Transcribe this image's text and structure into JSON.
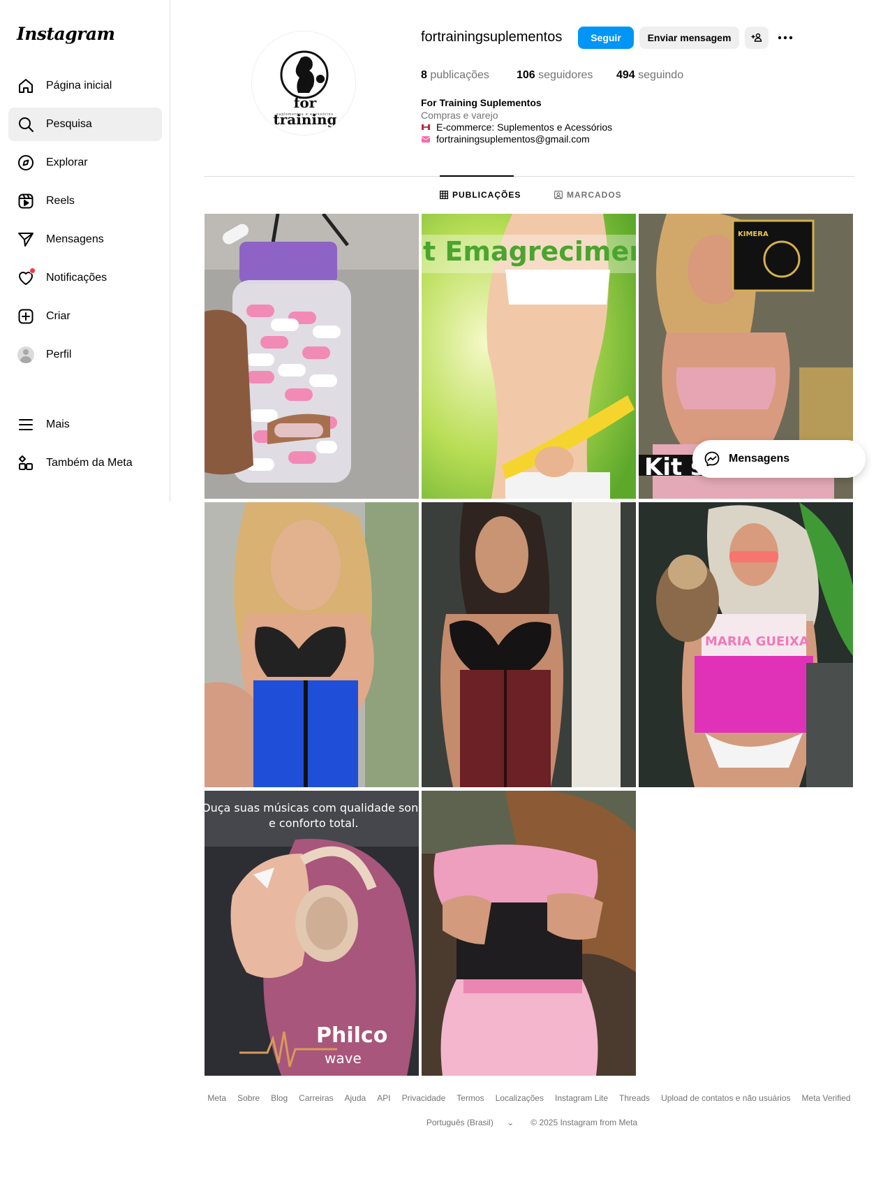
{
  "sidebar": {
    "logo": "Instagram",
    "items": [
      {
        "label": "Página inicial",
        "icon": "home-icon"
      },
      {
        "label": "Pesquisa",
        "icon": "search-icon"
      },
      {
        "label": "Explorar",
        "icon": "compass-icon"
      },
      {
        "label": "Reels",
        "icon": "reels-icon"
      },
      {
        "label": "Mensagens",
        "icon": "send-icon"
      },
      {
        "label": "Notificações",
        "icon": "heart-icon"
      },
      {
        "label": "Criar",
        "icon": "plus-square-icon"
      },
      {
        "label": "Perfil",
        "icon": "avatar-icon"
      },
      {
        "label": "Mais",
        "icon": "menu-icon"
      },
      {
        "label": "Também da Meta",
        "icon": "meta-apps-icon"
      }
    ]
  },
  "profile": {
    "username": "fortrainingsuplementos",
    "follow_label": "Seguir",
    "message_label": "Enviar mensagem",
    "logo_text_main": "for training",
    "logo_text_sub": "suplementos e acessórios",
    "stats": {
      "posts_count": "8",
      "posts_label": "publicações",
      "followers_count": "106",
      "followers_label": "seguidores",
      "following_count": "494",
      "following_label": "seguindo"
    },
    "bio": {
      "name": "For Training Suplementos",
      "category": "Compras e varejo",
      "line1": "E-commerce: Suplementos e Acessórios",
      "line2": "fortrainingsuplementos@gmail.com"
    }
  },
  "tabs": {
    "posts": "PUBLICAÇÕES",
    "tagged": "MARCADOS"
  },
  "posts": {
    "p2_text": "t Emagrecimen",
    "p3_text": "Kit seca e define",
    "p3_box": "KIMERA",
    "p6_text": "MARIA GUEIXA",
    "p7_text1": "Ouça suas músicas com qualidade sonora",
    "p7_text2": "e conforto total.",
    "p7_brand": "Philco",
    "p7_sub": "wave"
  },
  "floating": {
    "messages_label": "Mensagens"
  },
  "footer": {
    "links": [
      "Meta",
      "Sobre",
      "Blog",
      "Carreiras",
      "Ajuda",
      "API",
      "Privacidade",
      "Termos",
      "Localizações",
      "Instagram Lite",
      "Threads",
      "Upload de contatos e não usuários",
      "Meta Verified"
    ],
    "language": "Português (Brasil)",
    "copyright": "© 2025 Instagram from Meta"
  },
  "colors": {
    "primary_blue": "#0095f6",
    "notification_red": "#ff3040",
    "brand_pink": "#ff2fb0"
  }
}
